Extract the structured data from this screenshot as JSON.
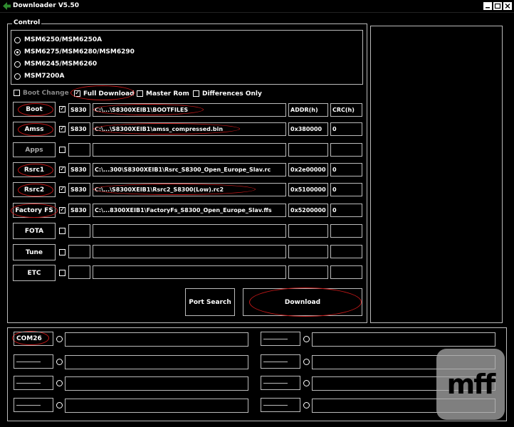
{
  "window": {
    "title": "Downloader V5.50"
  },
  "control": {
    "label": "Control",
    "chipsets": [
      {
        "label": "MSM6250/MSM6250A",
        "selected": false
      },
      {
        "label": "MSM6275/MSM6280/MSM6290",
        "selected": true
      },
      {
        "label": "MSM6245/MSM6260",
        "selected": false
      },
      {
        "label": "MSM7200A",
        "selected": false
      }
    ],
    "options": {
      "boot_change": {
        "label": "Boot Change",
        "checked": false
      },
      "full_download": {
        "label": "Full Download",
        "checked": true
      },
      "master_rom": {
        "label": "Master Rom",
        "checked": false
      },
      "differences_only": {
        "label": "Differences Only",
        "checked": false
      }
    },
    "headers": {
      "addr": "ADDR(h)",
      "crc": "CRC(h)"
    },
    "rows": [
      {
        "button": "Boot",
        "checked": true,
        "model": "S830",
        "path": "C:\\...\\S8300XEIB1\\BOOTFILES",
        "addr": "",
        "crc": ""
      },
      {
        "button": "Amss",
        "checked": true,
        "model": "S830",
        "path": "C:\\...\\S8300XEIB1\\amss_compressed.bin",
        "addr": "0x380000",
        "crc": "0"
      },
      {
        "button": "Apps",
        "checked": false,
        "model": "",
        "path": "",
        "addr": "",
        "crc": ""
      },
      {
        "button": "Rsrc1",
        "checked": true,
        "model": "S830",
        "path": "C:\\...300\\S8300XEIB1\\Rsrc_S8300_Open_Europe_Slav.rc",
        "addr": "0x2e00000",
        "crc": "0"
      },
      {
        "button": "Rsrc2",
        "checked": true,
        "model": "S830",
        "path": "C:\\...\\S8300XEIB1\\Rsrc2_S8300(Low).rc2",
        "addr": "0x5100000",
        "crc": "0"
      },
      {
        "button": "Factory FS",
        "checked": true,
        "model": "S830",
        "path": "C:\\...8300XEIB1\\FactoryFs_S8300_Open_Europe_Slav.ffs",
        "addr": "0x5200000",
        "crc": "0"
      },
      {
        "button": "FOTA",
        "checked": false,
        "model": "",
        "path": "",
        "addr": "",
        "crc": ""
      },
      {
        "button": "Tune",
        "checked": false,
        "model": "",
        "path": "",
        "addr": "",
        "crc": ""
      },
      {
        "button": "ETC",
        "checked": false,
        "model": "",
        "path": "",
        "addr": "",
        "crc": ""
      }
    ],
    "port_search_label": "Port Search",
    "download_label": "Download"
  },
  "ports": {
    "left": [
      "COM26",
      "",
      "",
      ""
    ],
    "right": [
      "",
      "",
      "",
      ""
    ]
  },
  "watermark": {
    "text": "mff"
  },
  "colors": {
    "background": "#000000",
    "border": "#bbbbbb",
    "annotation": "#c41818"
  }
}
